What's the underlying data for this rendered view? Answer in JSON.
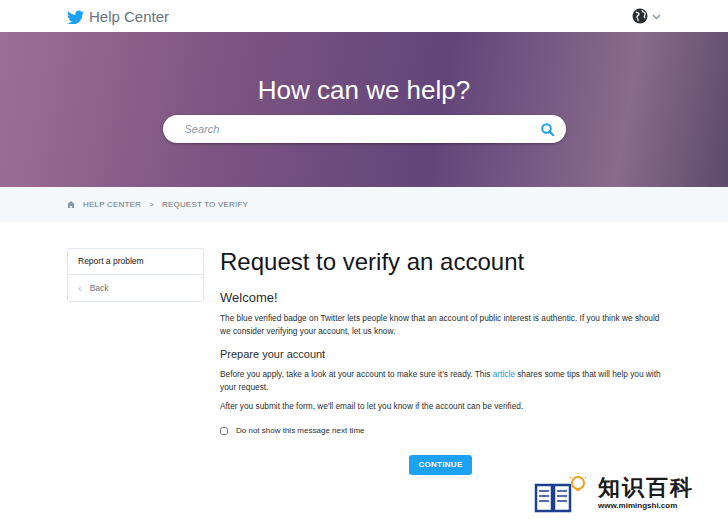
{
  "header": {
    "title": "Help Center"
  },
  "hero": {
    "title": "How can we help?"
  },
  "search": {
    "placeholder": "Search"
  },
  "breadcrumb": {
    "items": [
      {
        "label": "HELP CENTER"
      },
      {
        "label": "REQUEST TO VERIFY"
      }
    ],
    "separator": ">"
  },
  "sidebar": {
    "items": [
      {
        "label": "Report a problem",
        "icon": ""
      },
      {
        "label": "Back",
        "icon": "‹"
      }
    ]
  },
  "article": {
    "title": "Request to verify an account",
    "sections": [
      {
        "heading": "Welcome!",
        "paragraphs": [
          [
            {
              "text": "The blue verified badge on Twitter lets people know that an account of public interest is authentic. If you think we should we consider verifying your account, let us know.",
              "kind": "text"
            }
          ]
        ]
      },
      {
        "heading": "Prepare your account",
        "paragraphs": [
          [
            {
              "text": "Before you apply, take a look at your account to make sure it's ready. This ",
              "kind": "text"
            },
            {
              "text": "article",
              "kind": "link"
            },
            {
              "text": " shares some tips that will help you with your request.",
              "kind": "text"
            }
          ],
          [
            {
              "text": "After you submit the form, we'll email to let you know if the account can be verified.",
              "kind": "text"
            }
          ]
        ]
      }
    ]
  },
  "checkbox": {
    "label": "Do not show this message next time",
    "checked": false
  },
  "button": {
    "label": "CONTINUE"
  },
  "watermark": {
    "title": "知识百科",
    "url": "www.mimingshi.com"
  }
}
